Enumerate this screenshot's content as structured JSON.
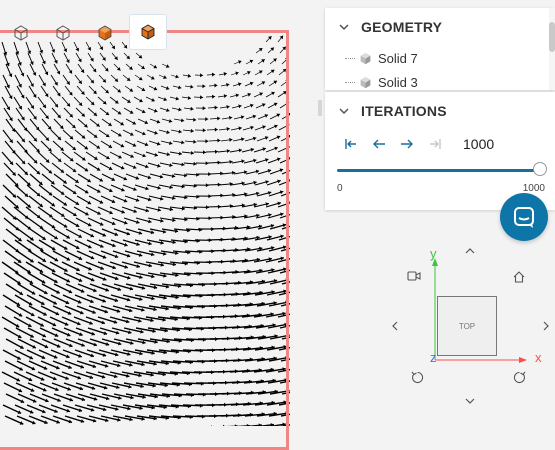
{
  "toolbar": {
    "buttons": [
      {
        "icon": "cube-outline-icon"
      },
      {
        "icon": "cube-outline-icon"
      },
      {
        "icon": "cube-solid-icon"
      },
      {
        "icon": "cube-solid-icon",
        "active": true
      }
    ]
  },
  "geometry": {
    "title": "GEOMETRY",
    "items": [
      {
        "label": "Solid 7"
      },
      {
        "label": "Solid 3"
      }
    ]
  },
  "iterations": {
    "title": "ITERATIONS",
    "value": "1000",
    "slider": {
      "min": "0",
      "max": "1000",
      "fraction": 1.0
    }
  },
  "navigation": {
    "cube_label": "TOP",
    "axes": {
      "x": "x",
      "y": "y",
      "z": "z"
    }
  },
  "colors": {
    "accent": "#1a6f9a",
    "chat": "#0d75a8",
    "domain_border": "#f08582",
    "cube_orange": "#e2731c",
    "axis_x": "#ff4b4b",
    "axis_y": "#3ec43e",
    "axis_z": "#4a6cff"
  }
}
